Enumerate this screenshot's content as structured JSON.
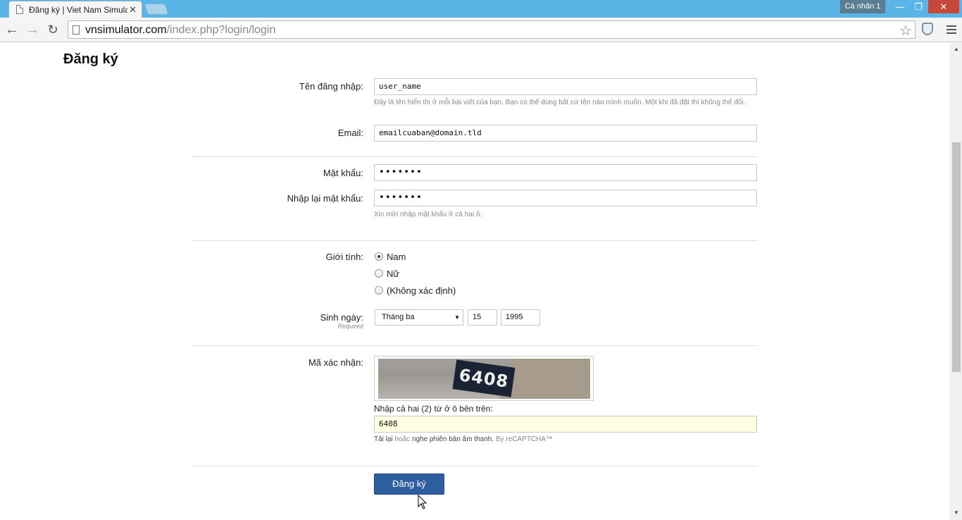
{
  "browser": {
    "tab_title": "Đăng ký | Viet Nam Simulator",
    "tab_close": "✕",
    "profile_label": "Cá nhân 1",
    "url_host": "vnsimulator.com",
    "url_path": "/index.php?login/login",
    "icons": [
      "page-icon",
      "back-icon",
      "forward-icon",
      "reload-icon",
      "star-icon",
      "extension-icon",
      "menu-icon"
    ]
  },
  "page": {
    "title": "Đăng ký",
    "username_label": "Tên đăng nhập:",
    "username_value": "user_name",
    "username_hint": "Đây là tên hiển thị ở mỗi bài viết của bạn. Bạn có thể dùng bất cứ tên nào mình muốn. Một khi đã đặt thì không thể đổi.",
    "email_label": "Email:",
    "email_value": "emailcuaban@domain.tld",
    "password_label": "Mật khẩu:",
    "password_value": "•••••••",
    "password_confirm_label": "Nhập lại mật khẩu:",
    "password_confirm_value": "•••••••",
    "password_hint": "Xin mời nhập mật khẩu ở cả hai ô.",
    "gender_label": "Giới tính:",
    "gender_options": [
      "Nam",
      "Nữ",
      "(Không xác định)"
    ],
    "gender_selected": "Nam",
    "birthday_label": "Sinh ngày:",
    "birthday_required": "Required",
    "birthday_month": "Tháng ba",
    "birthday_day": "15",
    "birthday_year": "1995",
    "captcha_label": "Mã xác nhận:",
    "captcha_image_text": "6408",
    "captcha_instruction": "Nhập cả hai (2) từ ở ô bên trên:",
    "captcha_value": "6408",
    "captcha_reload": "Tải lại",
    "captcha_or": "hoặc",
    "captcha_audio": "nghe phiên bản âm thanh.",
    "captcha_by": "By reCAPTCHA™",
    "submit_label": "Đăng ký"
  }
}
